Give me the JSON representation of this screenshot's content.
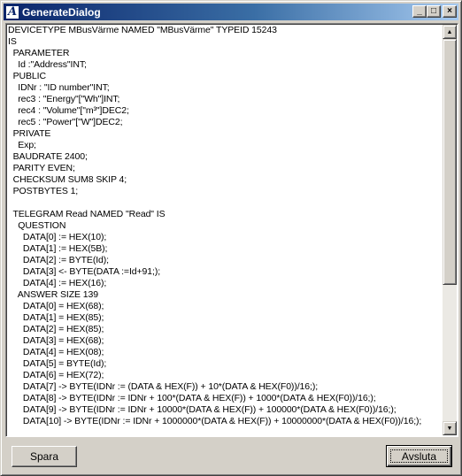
{
  "window": {
    "title": "GenerateDialog",
    "icon": "A",
    "minimize_label": "_",
    "maximize_label": "□",
    "close_label": "×"
  },
  "editor": {
    "lines": [
      "DEVICETYPE MBusVärme NAMED \"MBusVärme\" TYPEID 15243",
      "IS",
      "  PARAMETER",
      "    Id :\"Address\"INT;",
      "  PUBLIC",
      "    IDNr : \"ID number\"INT;",
      "    rec3 : \"Energy\"[\"Wh\"]INT;",
      "    rec4 : \"Volume\"[\"m³\"]DEC2;",
      "    rec5 : \"Power\"[\"W\"]DEC2;",
      "  PRIVATE",
      "    Exp;",
      "  BAUDRATE 2400;",
      "  PARITY EVEN;",
      "  CHECKSUM SUM8 SKIP 4;",
      "  POSTBYTES 1;",
      "",
      "  TELEGRAM Read NAMED \"Read\" IS",
      "    QUESTION",
      "      DATA[0] := HEX(10);",
      "      DATA[1] := HEX(5B);",
      "      DATA[2] := BYTE(Id);",
      "      DATA[3] <- BYTE(DATA :=Id+91;);",
      "      DATA[4] := HEX(16);",
      "    ANSWER SIZE 139",
      "      DATA[0] = HEX(68);",
      "      DATA[1] = HEX(85);",
      "      DATA[2] = HEX(85);",
      "      DATA[3] = HEX(68);",
      "      DATA[4] = HEX(08);",
      "      DATA[5] = BYTE(Id);",
      "      DATA[6] = HEX(72);",
      "      DATA[7] -> BYTE(IDNr := (DATA & HEX(F)) + 10*(DATA & HEX(F0))/16;);",
      "      DATA[8] -> BYTE(IDNr := IDNr + 100*(DATA & HEX(F)) + 1000*(DATA & HEX(F0))/16;);",
      "      DATA[9] -> BYTE(IDNr := IDNr + 10000*(DATA & HEX(F)) + 100000*(DATA & HEX(F0))/16;);",
      "      DATA[10] -> BYTE(IDNr := IDNr + 1000000*(DATA & HEX(F)) + 10000000*(DATA & HEX(F0))/16;);"
    ]
  },
  "buttons": {
    "save_label": "Spara",
    "exit_label": "Avsluta"
  },
  "scrollbar": {
    "up_icon": "▲",
    "down_icon": "▼"
  }
}
